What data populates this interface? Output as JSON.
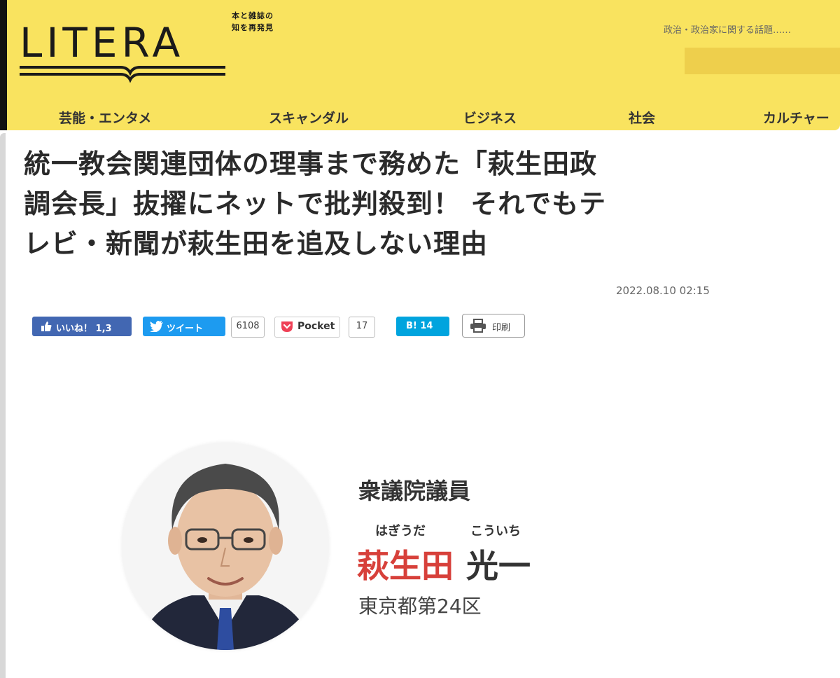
{
  "site": {
    "logo_text": "LITERA",
    "tagline_line1": "本と雑誌の",
    "tagline_line2": "知を再発見",
    "top_note": "政治・政治家に関する話題……"
  },
  "nav": {
    "items": [
      "芸能・エンタメ",
      "スキャンダル",
      "ビジネス",
      "社会",
      "カルチャー"
    ]
  },
  "article": {
    "title_line1": "統一教会関連団体の理事まで務めた「萩生田政",
    "title_line2": "調会長」抜擢にネットで批判殺到！ それでもテ",
    "title_line3": "レビ・新聞が萩生田を追及しない理由",
    "date": "2022.08.10 02:15"
  },
  "share": {
    "like_label": "いいね！ 1,3",
    "tweet_label": "ツイート",
    "tweet_count": "6108",
    "pocket_label": "Pocket",
    "pocket_count": "17",
    "hatena_label": "B! 14",
    "print_label": "印刷"
  },
  "profile": {
    "role": "衆議院議員",
    "ruby_surname": "はぎうだ",
    "ruby_given": "こういち",
    "surname": "萩生田",
    "given_name": "光一",
    "district": "東京都第24区"
  },
  "colors": {
    "header_bg": "#f9e35f",
    "surname_red": "#d7403a",
    "facebook_blue": "#4267b2",
    "twitter_blue": "#1d9bf0",
    "hatena_blue": "#00a4de"
  }
}
